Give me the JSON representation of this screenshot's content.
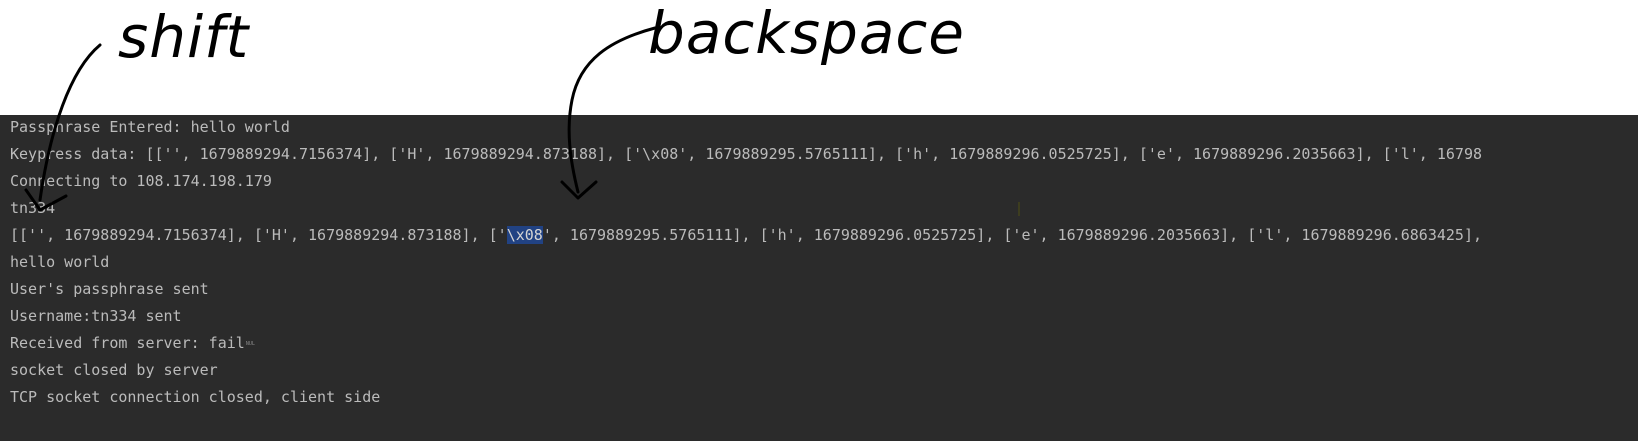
{
  "annotations": {
    "shift_label": "shift",
    "backspace_label": "backspace"
  },
  "console": {
    "lines": [
      "Passphrase Entered: hello world",
      "Keypress data: [['', 1679889294.7156374], ['H', 1679889294.873188], ['\\x08', 1679889295.5765111], ['h', 1679889296.0525725], ['e', 1679889296.2035663], ['l', 16798",
      "Connecting to 108.174.198.179",
      "tn334",
      "",
      "hello world",
      "User's passphrase sent",
      "Username:tn334 sent",
      "Received from server: fail",
      "socket closed by server",
      "TCP socket connection closed, client side"
    ],
    "line5_before": "[['', 1679889294.7156374], ['H', 1679889294.873188], ['",
    "line5_selected": "\\x08",
    "line5_after": "', 1679889295.5765111], ['h', 1679889296.0525725], ['e', 1679889296.2035663], ['l', 1679889296.6863425],",
    "nul_marker": "NUL"
  },
  "colors": {
    "console_bg": "#2b2b2b",
    "console_text": "#bbbbbb",
    "selection_bg": "#214283",
    "annotation_ink": "#000000"
  }
}
